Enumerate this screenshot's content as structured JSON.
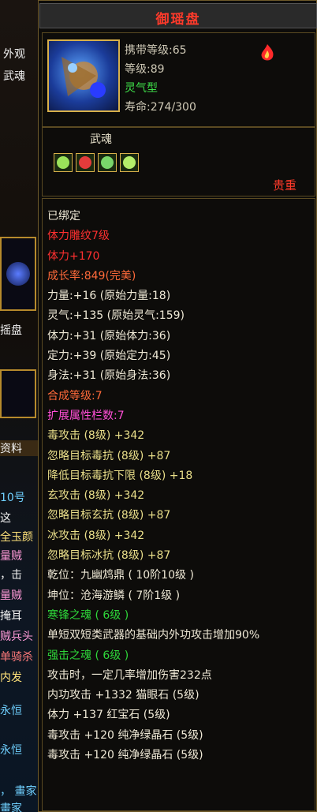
{
  "left": {
    "texts": [
      "外观",
      "武魂",
      "摇盘",
      "资料",
      "10号",
      "这",
      "全玉颜",
      "量贼",
      "，击",
      "量贼",
      "掩耳",
      "贼兵头",
      "单骑杀",
      "内发",
      "永恒",
      "永恒",
      "， 畫家",
      "畫家"
    ]
  },
  "item": {
    "name": "御瑶盘",
    "carry_level": "携带等级:65",
    "level": "等级:89",
    "type": "灵气型",
    "life": "寿命:274/300",
    "soul_label": "武魂",
    "rarity": "贵重",
    "gem_colors": [
      "#9be35a",
      "#e23b3b",
      "#7ad66a",
      "#b4ee6a"
    ]
  },
  "attributes": [
    {
      "text": "已绑定",
      "color": "w"
    },
    {
      "text": "体力雕纹7级",
      "color": "r"
    },
    {
      "text": "体力+170",
      "color": "r"
    },
    {
      "text": "成长率:849(完美)",
      "color": "o"
    },
    {
      "text": "力量:+16 (原始力量:18)",
      "color": "w"
    },
    {
      "text": "灵气:+135 (原始灵气:159)",
      "color": "w"
    },
    {
      "text": "体力:+31 (原始体力:36)",
      "color": "w"
    },
    {
      "text": "定力:+39 (原始定力:45)",
      "color": "w"
    },
    {
      "text": "身法:+31 (原始身法:36)",
      "color": "w"
    },
    {
      "text": "合成等级:7",
      "color": "o"
    },
    {
      "text": "扩展属性栏数:7",
      "color": "m"
    },
    {
      "text": "毒攻击 (8级) +342",
      "color": "y"
    },
    {
      "text": "忽略目标毒抗 (8级) +87",
      "color": "y"
    },
    {
      "text": "降低目标毒抗下限 (8级) +18",
      "color": "y"
    },
    {
      "text": "玄攻击 (8级) +342",
      "color": "y"
    },
    {
      "text": "忽略目标玄抗 (8级) +87",
      "color": "y"
    },
    {
      "text": "冰攻击 (8级) +342",
      "color": "y"
    },
    {
      "text": "忽略目标冰抗 (8级) +87",
      "color": "y"
    },
    {
      "text": "乾位：九幽鸩鼎 ( 10阶10级 )",
      "color": "w"
    },
    {
      "text": "坤位：沧海游鳞 ( 7阶1级 )",
      "color": "w"
    },
    {
      "text": "寒锋之魂 ( 6级 )",
      "color": "g"
    },
    {
      "text": "单短双短类武器的基础内外功攻击增加90%",
      "color": "w",
      "wrap": true
    },
    {
      "text": "强击之魂 ( 6级 )",
      "color": "g"
    },
    {
      "text": "攻击时，一定几率增加伤害232点",
      "color": "w"
    },
    {
      "text": "内功攻击 +1332 猫眼石 (5级)",
      "color": "w"
    },
    {
      "text": "体力 +137 红宝石 (5级)",
      "color": "w"
    },
    {
      "text": "毒攻击 +120 纯净绿晶石 (5级)",
      "color": "w"
    },
    {
      "text": "毒攻击 +120 纯净绿晶石 (5级)",
      "color": "w"
    }
  ]
}
